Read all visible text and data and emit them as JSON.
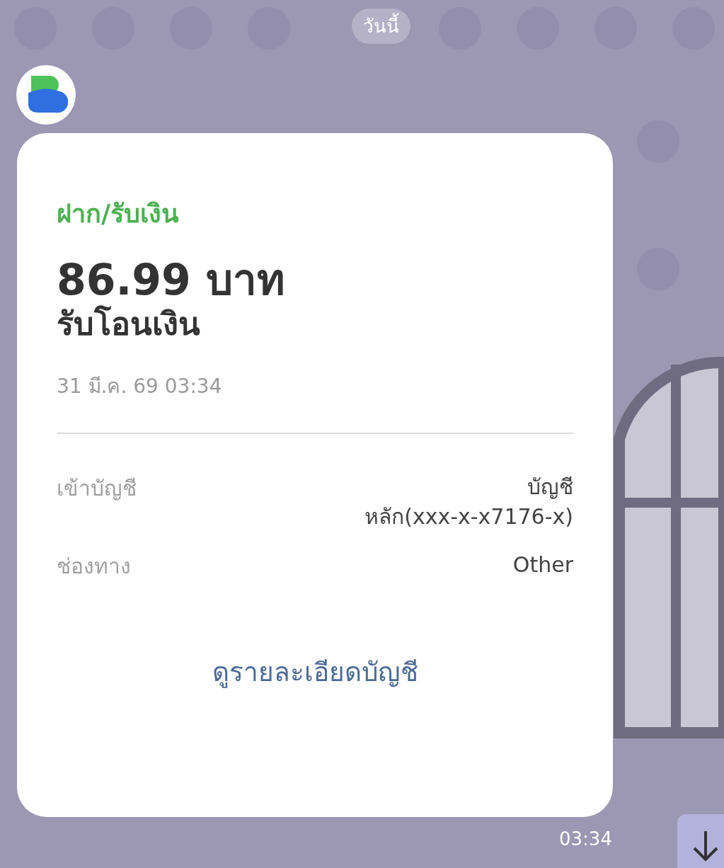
{
  "date_chip": "วันนี้",
  "message": {
    "category": "ฝาก/รับเงิน",
    "amount": "86.99 บาท",
    "type": "รับโอนเงิน",
    "datetime": "31 มี.ค. 69 03:34",
    "details": [
      {
        "label": "เข้าบัญชี",
        "value": "บัญชี\nหลัก(xxx-x-x7176-x)"
      },
      {
        "label": "ช่องทาง",
        "value": "Other"
      }
    ],
    "link": "ดูรายละเอียดบัญชี",
    "time": "03:34"
  }
}
